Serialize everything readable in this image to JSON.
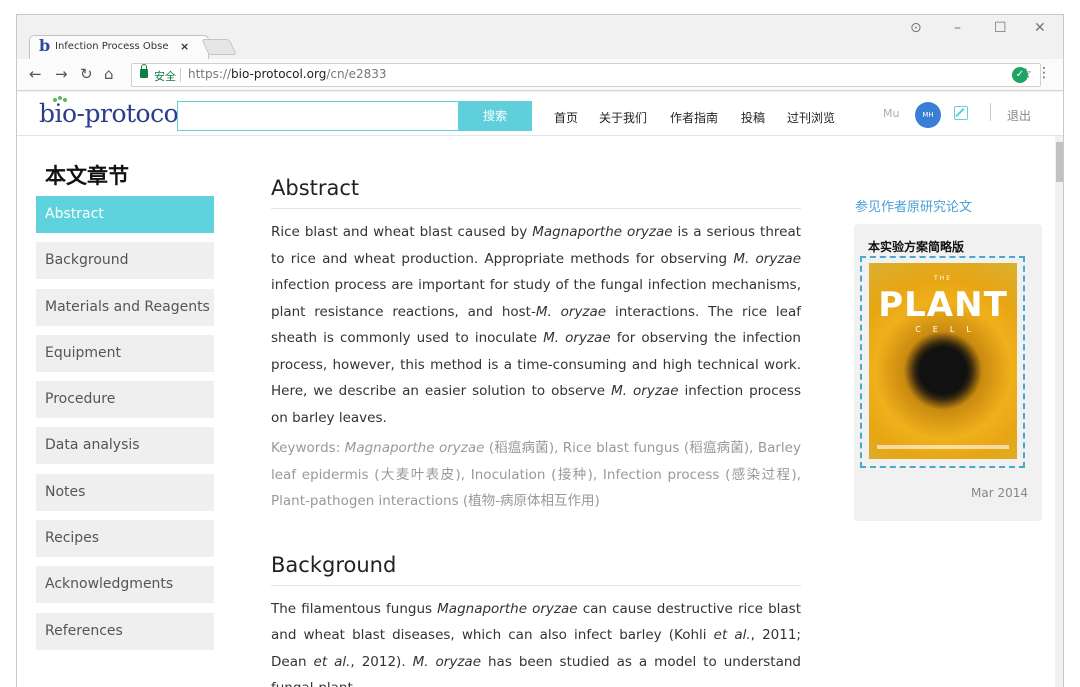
{
  "browser": {
    "tab_title": "Infection Process Obse",
    "tab_close": "×",
    "url_secure_label": "安全",
    "url_scheme": "https://",
    "url_host": "bio-protocol.org",
    "url_path": "/cn/e2833",
    "back": "←",
    "forward": "→",
    "reload": "↻",
    "home": "⌂",
    "star": "☆",
    "menu": "⋮",
    "account_icon": "account-circle-icon",
    "minimize": "–",
    "maximize": "☐",
    "close": "✕",
    "ext_label": "✓"
  },
  "site": {
    "logo": "bio-protocol",
    "search_button": "搜索",
    "search_value": "",
    "nav": [
      "首页",
      "关于我们",
      "作者指南",
      "投稿",
      "过刊浏览"
    ],
    "user_name": "Mu",
    "avatar_text": "MH",
    "logout": "退出",
    "accent": "#60cfdc"
  },
  "sidebar": {
    "title": "本文章节",
    "items": [
      {
        "label": "Abstract",
        "active": true
      },
      {
        "label": "Background"
      },
      {
        "label": "Materials and Reagents"
      },
      {
        "label": "Equipment"
      },
      {
        "label": "Procedure"
      },
      {
        "label": "Data analysis"
      },
      {
        "label": "Notes"
      },
      {
        "label": "Recipes"
      },
      {
        "label": "Acknowledgments"
      },
      {
        "label": "References"
      }
    ]
  },
  "abstract": {
    "heading": "Abstract",
    "p1_a": "Rice blast and wheat blast caused by ",
    "species": "Magnaporthe oryzae",
    "p1_b": " is a serious threat to rice and wheat production. Appropriate methods for observing ",
    "short_species": "M. oryzae",
    "p1_c": " infection process are important for study of the fungal infection mechanisms, plant resistance reactions, and host-",
    "p1_d": " interactions. The rice leaf sheath is commonly used to inoculate ",
    "p1_e": " for observing the infection process, however, this method is a time-consuming and high technical work. Here, we describe an easier solution to observe ",
    "p1_f": " infection process on barley leaves.",
    "keywords_label": "Keywords: ",
    "keywords_rest": " (稻瘟病菌), Rice blast fungus (稻瘟病菌), Barley leaf epidermis (大麦叶表皮), Inoculation (接种), Infection process (感染过程), Plant-pathogen interactions (植物-病原体相互作用)"
  },
  "background": {
    "heading": "Background",
    "p_a": "The filamentous fungus ",
    "p_b": " can cause destructive rice blast and wheat blast diseases, which can also infect barley (Kohli ",
    "etal": "et al.",
    "p_c": ", 2011; Dean ",
    "p_d": ", 2012). ",
    "p_e": " has been studied as a model to understand fungal-plant"
  },
  "right": {
    "see_link": "参见作者原研究论文",
    "card_title": "本实验方案简略版",
    "cover_the": "THE",
    "cover_title": "PLANT",
    "cover_sub": "CELL",
    "date": "Mar 2014"
  }
}
